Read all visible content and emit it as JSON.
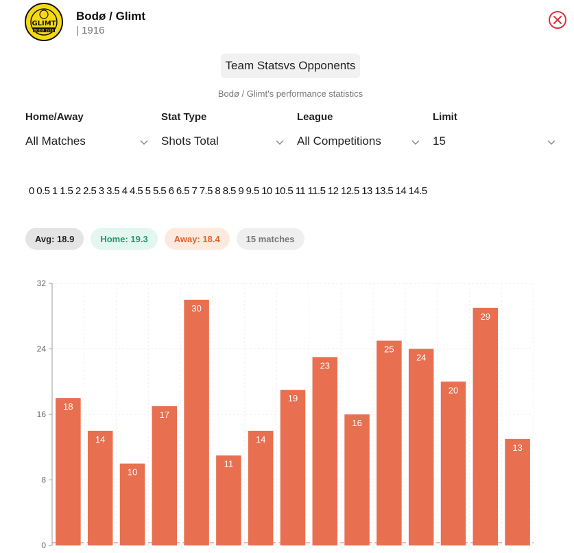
{
  "header": {
    "team_name": "Bodø / Glimt",
    "year": "| 1916",
    "logo_text": "GLIMT",
    "logo_subtext": "BODØ 1916"
  },
  "title_button": "Team Statsvs Opponents",
  "subtitle": "Bodø / Glimt's performance statistics",
  "filters": [
    {
      "label": "Home/Away",
      "value": "All Matches"
    },
    {
      "label": "Stat Type",
      "value": "Shots Total"
    },
    {
      "label": "League",
      "value": "All Competitions"
    },
    {
      "label": "Limit",
      "value": "15"
    }
  ],
  "slider_ticks": "0 0.5 1 1.5 2 2.5 3 3.5 4 4.5 5 5.5 6 6.5 7 7.5 8 8.5 9 9.5 10 10.5 11 11.5 12 12.5 13 13.5 14 14.5",
  "summary": {
    "avg": "Avg: 18.9",
    "home": "Home: 19.3",
    "away": "Away: 18.4",
    "matches": "15 matches"
  },
  "colors": {
    "bar": "#e86f50",
    "close": "#e0303a",
    "avg_line": "#e86f50"
  },
  "chart_data": {
    "type": "bar",
    "values": [
      18,
      14,
      10,
      17,
      30,
      11,
      14,
      19,
      23,
      16,
      25,
      24,
      20,
      29,
      13
    ],
    "yticks": [
      "0",
      "8",
      "16",
      "24",
      "32"
    ],
    "ylim": [
      0,
      32
    ],
    "grid": true,
    "average": 18.9
  }
}
